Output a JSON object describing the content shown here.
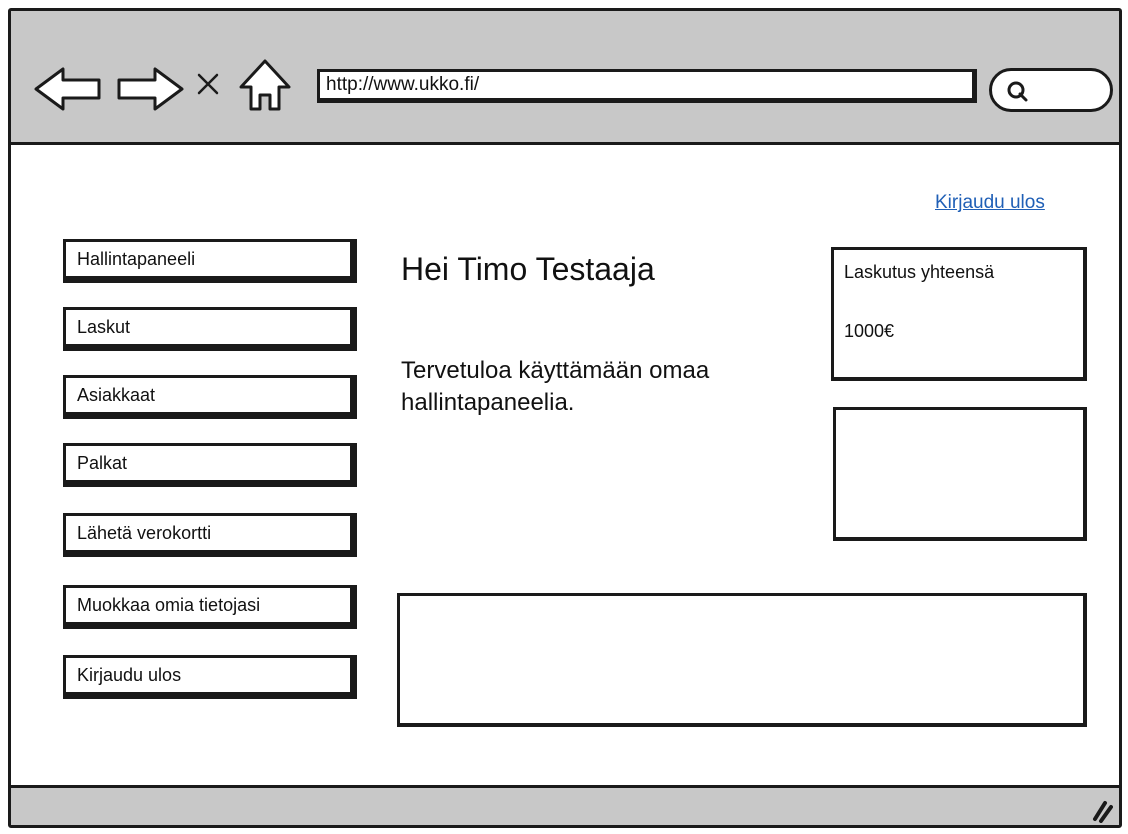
{
  "browser": {
    "url": "http://www.ukko.fi/"
  },
  "header": {
    "logout_link": "Kirjaudu ulos"
  },
  "sidebar": {
    "items": [
      {
        "label": "Hallintapaneeli"
      },
      {
        "label": "Laskut"
      },
      {
        "label": "Asiakkaat"
      },
      {
        "label": "Palkat"
      },
      {
        "label": "Lähetä verokortti"
      },
      {
        "label": "Muokkaa omia tietojasi"
      },
      {
        "label": "Kirjaudu ulos"
      }
    ]
  },
  "main": {
    "greeting": "Hei Timo Testaaja",
    "welcome": "Tervetuloa käyttämään omaa hallintapaneelia."
  },
  "billing_card": {
    "title": "Laskutus yhteensä",
    "value": "1000€"
  },
  "icons": {
    "back": "arrow-left-icon",
    "forward": "arrow-right-icon",
    "stop": "close-icon",
    "home": "home-icon",
    "search": "search-icon",
    "resize": "resize-grip-icon"
  },
  "colors": {
    "toolbar_bg": "#c8c8c8",
    "link": "#1f5fb6",
    "border": "#1a1a1a"
  }
}
